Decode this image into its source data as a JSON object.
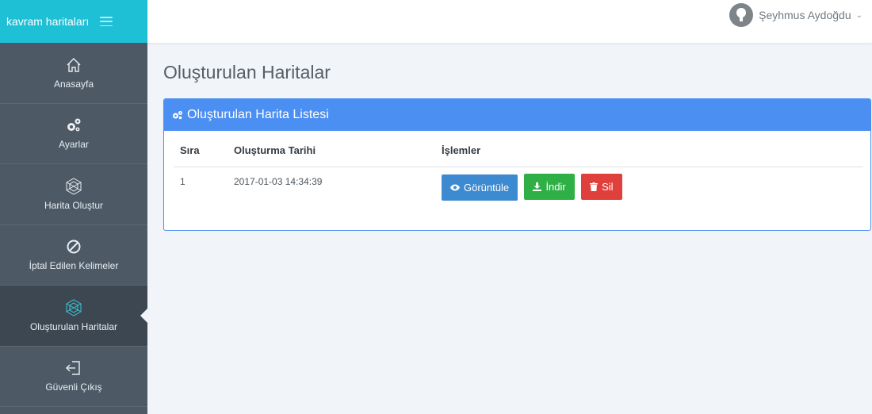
{
  "app": {
    "brand": "kavram haritaları"
  },
  "sidebar": {
    "items": [
      {
        "label": "Anasayfa",
        "icon": "home-icon"
      },
      {
        "label": "Ayarlar",
        "icon": "gears-icon"
      },
      {
        "label": "Harita Oluştur",
        "icon": "map-network-icon"
      },
      {
        "label": "İptal Edilen Kelimeler",
        "icon": "ban-icon"
      },
      {
        "label": "Oluşturulan Haritalar",
        "icon": "map-network-icon",
        "active": true
      },
      {
        "label": "Güvenli Çıkış",
        "icon": "logout-icon"
      }
    ]
  },
  "topbar": {
    "user_name": "Şeyhmus Aydoğdu",
    "caret": "⌄"
  },
  "main": {
    "page_title": "Oluşturulan Haritalar",
    "panel_title": "Oluşturulan Harita Listesi",
    "table": {
      "headers": [
        "Sıra",
        "Oluşturma Tarihi",
        "İşlemler"
      ],
      "rows": [
        {
          "index": "1",
          "date": "2017-01-03 14:34:39"
        }
      ]
    },
    "actions": {
      "view": "Görüntüle",
      "download": "İndir",
      "delete": "Sil"
    }
  },
  "colors": {
    "brand": "#1ec0d6",
    "sidebar": "#4d5a66",
    "panel_header": "#4b8ff3",
    "view_button": "#3d8ad0",
    "download_button": "#2fb046",
    "delete_button": "#e0403c"
  }
}
